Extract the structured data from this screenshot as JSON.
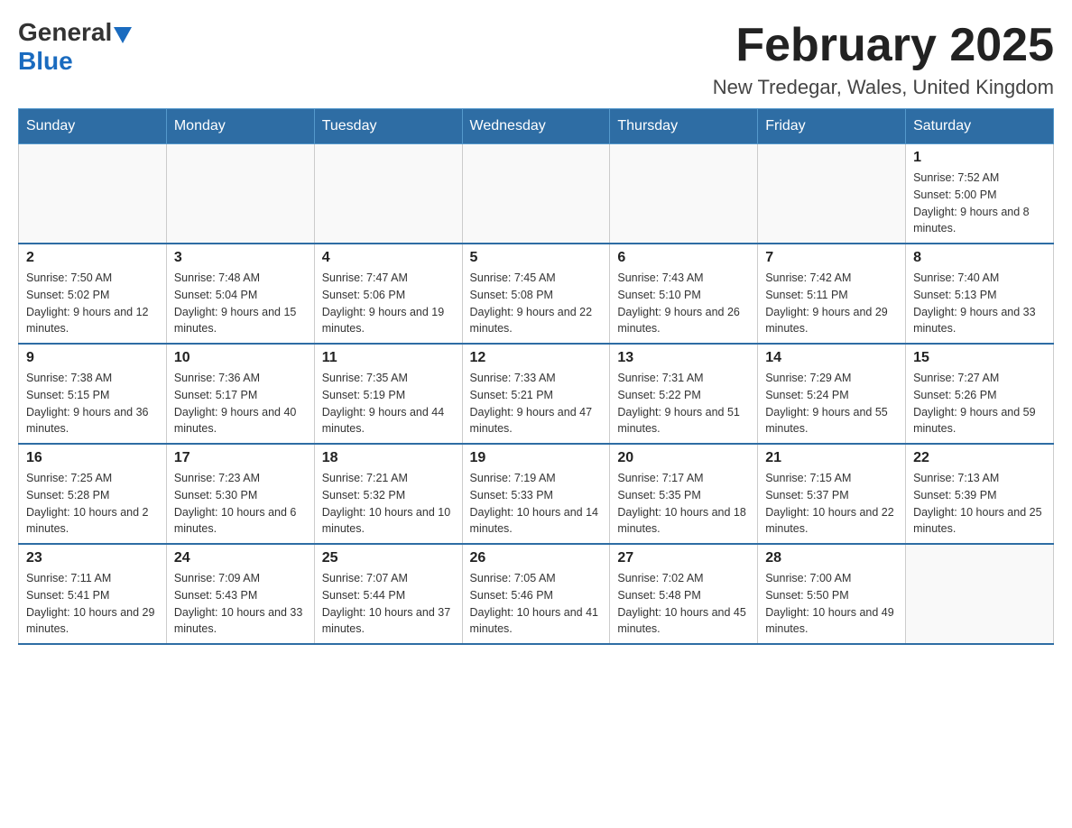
{
  "header": {
    "logo_general": "General",
    "logo_blue": "Blue",
    "title": "February 2025",
    "subtitle": "New Tredegar, Wales, United Kingdom"
  },
  "days_of_week": [
    "Sunday",
    "Monday",
    "Tuesday",
    "Wednesday",
    "Thursday",
    "Friday",
    "Saturday"
  ],
  "weeks": [
    [
      {
        "day": "",
        "info": ""
      },
      {
        "day": "",
        "info": ""
      },
      {
        "day": "",
        "info": ""
      },
      {
        "day": "",
        "info": ""
      },
      {
        "day": "",
        "info": ""
      },
      {
        "day": "",
        "info": ""
      },
      {
        "day": "1",
        "info": "Sunrise: 7:52 AM\nSunset: 5:00 PM\nDaylight: 9 hours and 8 minutes."
      }
    ],
    [
      {
        "day": "2",
        "info": "Sunrise: 7:50 AM\nSunset: 5:02 PM\nDaylight: 9 hours and 12 minutes."
      },
      {
        "day": "3",
        "info": "Sunrise: 7:48 AM\nSunset: 5:04 PM\nDaylight: 9 hours and 15 minutes."
      },
      {
        "day": "4",
        "info": "Sunrise: 7:47 AM\nSunset: 5:06 PM\nDaylight: 9 hours and 19 minutes."
      },
      {
        "day": "5",
        "info": "Sunrise: 7:45 AM\nSunset: 5:08 PM\nDaylight: 9 hours and 22 minutes."
      },
      {
        "day": "6",
        "info": "Sunrise: 7:43 AM\nSunset: 5:10 PM\nDaylight: 9 hours and 26 minutes."
      },
      {
        "day": "7",
        "info": "Sunrise: 7:42 AM\nSunset: 5:11 PM\nDaylight: 9 hours and 29 minutes."
      },
      {
        "day": "8",
        "info": "Sunrise: 7:40 AM\nSunset: 5:13 PM\nDaylight: 9 hours and 33 minutes."
      }
    ],
    [
      {
        "day": "9",
        "info": "Sunrise: 7:38 AM\nSunset: 5:15 PM\nDaylight: 9 hours and 36 minutes."
      },
      {
        "day": "10",
        "info": "Sunrise: 7:36 AM\nSunset: 5:17 PM\nDaylight: 9 hours and 40 minutes."
      },
      {
        "day": "11",
        "info": "Sunrise: 7:35 AM\nSunset: 5:19 PM\nDaylight: 9 hours and 44 minutes."
      },
      {
        "day": "12",
        "info": "Sunrise: 7:33 AM\nSunset: 5:21 PM\nDaylight: 9 hours and 47 minutes."
      },
      {
        "day": "13",
        "info": "Sunrise: 7:31 AM\nSunset: 5:22 PM\nDaylight: 9 hours and 51 minutes."
      },
      {
        "day": "14",
        "info": "Sunrise: 7:29 AM\nSunset: 5:24 PM\nDaylight: 9 hours and 55 minutes."
      },
      {
        "day": "15",
        "info": "Sunrise: 7:27 AM\nSunset: 5:26 PM\nDaylight: 9 hours and 59 minutes."
      }
    ],
    [
      {
        "day": "16",
        "info": "Sunrise: 7:25 AM\nSunset: 5:28 PM\nDaylight: 10 hours and 2 minutes."
      },
      {
        "day": "17",
        "info": "Sunrise: 7:23 AM\nSunset: 5:30 PM\nDaylight: 10 hours and 6 minutes."
      },
      {
        "day": "18",
        "info": "Sunrise: 7:21 AM\nSunset: 5:32 PM\nDaylight: 10 hours and 10 minutes."
      },
      {
        "day": "19",
        "info": "Sunrise: 7:19 AM\nSunset: 5:33 PM\nDaylight: 10 hours and 14 minutes."
      },
      {
        "day": "20",
        "info": "Sunrise: 7:17 AM\nSunset: 5:35 PM\nDaylight: 10 hours and 18 minutes."
      },
      {
        "day": "21",
        "info": "Sunrise: 7:15 AM\nSunset: 5:37 PM\nDaylight: 10 hours and 22 minutes."
      },
      {
        "day": "22",
        "info": "Sunrise: 7:13 AM\nSunset: 5:39 PM\nDaylight: 10 hours and 25 minutes."
      }
    ],
    [
      {
        "day": "23",
        "info": "Sunrise: 7:11 AM\nSunset: 5:41 PM\nDaylight: 10 hours and 29 minutes."
      },
      {
        "day": "24",
        "info": "Sunrise: 7:09 AM\nSunset: 5:43 PM\nDaylight: 10 hours and 33 minutes."
      },
      {
        "day": "25",
        "info": "Sunrise: 7:07 AM\nSunset: 5:44 PM\nDaylight: 10 hours and 37 minutes."
      },
      {
        "day": "26",
        "info": "Sunrise: 7:05 AM\nSunset: 5:46 PM\nDaylight: 10 hours and 41 minutes."
      },
      {
        "day": "27",
        "info": "Sunrise: 7:02 AM\nSunset: 5:48 PM\nDaylight: 10 hours and 45 minutes."
      },
      {
        "day": "28",
        "info": "Sunrise: 7:00 AM\nSunset: 5:50 PM\nDaylight: 10 hours and 49 minutes."
      },
      {
        "day": "",
        "info": ""
      }
    ]
  ]
}
